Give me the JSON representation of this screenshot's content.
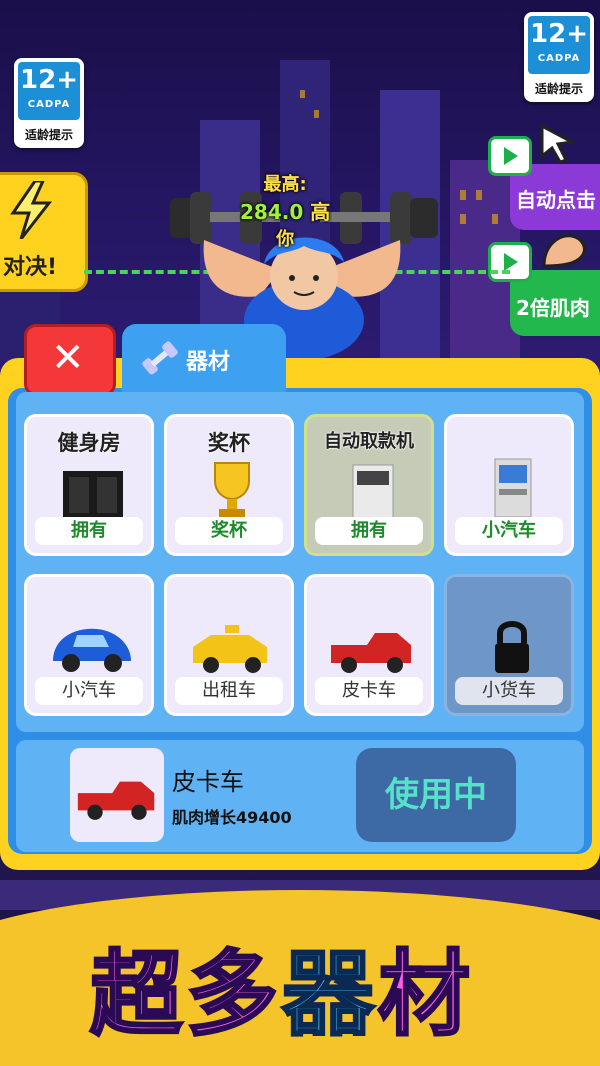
{
  "badges": [
    {
      "age": "12+",
      "org": "CADPA",
      "tip": "适龄提示"
    },
    {
      "age": "12+",
      "org": "CADPA",
      "tip": "适龄提示"
    }
  ],
  "side": {
    "duel_label": "对决!",
    "auto_click_label": "自动点击",
    "double_muscle_label": "2倍肌肉"
  },
  "record": {
    "label": "最高:",
    "value": "284.0",
    "unit": "高",
    "you": "你"
  },
  "tabs": {
    "equipment_label": "器材"
  },
  "items": [
    {
      "name": "健身房",
      "footer": "拥有",
      "state": "owned-text"
    },
    {
      "name": "奖杯",
      "footer": "奖杯",
      "state": "normal"
    },
    {
      "name": "自动取款机",
      "footer": "拥有",
      "state": "owned"
    },
    {
      "name": "",
      "footer": "小汽车",
      "state": "normal"
    },
    {
      "name": "",
      "footer": "小汽车",
      "state": "normal"
    },
    {
      "name": "",
      "footer": "出租车",
      "state": "normal"
    },
    {
      "name": "",
      "footer": "皮卡车",
      "state": "normal"
    },
    {
      "name": "",
      "footer": "小货车",
      "state": "locked"
    }
  ],
  "selected": {
    "name": "皮卡车",
    "stat": "肌肉增长49400",
    "button": "使用中"
  },
  "banner": {
    "c1": "超",
    "c2": "多",
    "c3": "器",
    "c4": "材"
  },
  "colors": {
    "panel": "#ffd21f",
    "inner": "#2f8fe6",
    "accent_green": "#1cb04a",
    "close_red": "#f4383a"
  }
}
